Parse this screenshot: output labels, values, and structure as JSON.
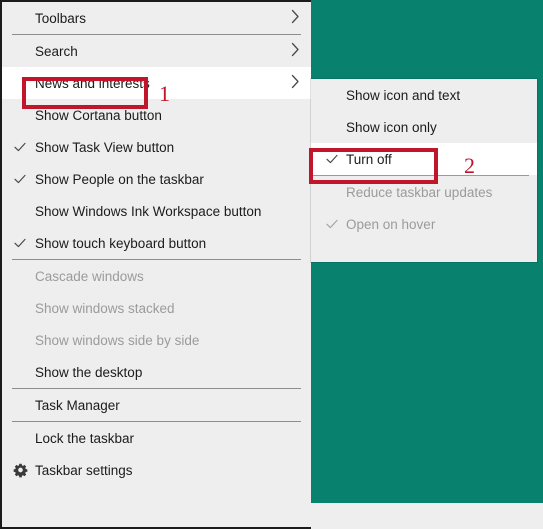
{
  "desktop": {
    "background_color": "#08826f",
    "bottom_strip_color": "#eeeeee"
  },
  "annotations": {
    "accent_color": "#c0152b",
    "step_one": "1",
    "step_two": "2",
    "step_one_target": "News and interests",
    "step_two_target": "Turn off"
  },
  "context_menu": {
    "name": "taskbar-context-menu",
    "background_color": "#eeeeee",
    "items": [
      {
        "label": "Toolbars",
        "checked": false,
        "submenu": true,
        "disabled": false,
        "highlighted": false,
        "icon": null
      },
      {
        "separator": true
      },
      {
        "label": "Search",
        "checked": false,
        "submenu": true,
        "disabled": false,
        "highlighted": false,
        "icon": null
      },
      {
        "label": "News and interests",
        "checked": false,
        "submenu": true,
        "disabled": false,
        "highlighted": true,
        "icon": null
      },
      {
        "label": "Show Cortana button",
        "checked": false,
        "submenu": false,
        "disabled": false,
        "highlighted": false,
        "icon": null
      },
      {
        "label": "Show Task View button",
        "checked": true,
        "submenu": false,
        "disabled": false,
        "highlighted": false,
        "icon": null
      },
      {
        "label": "Show People on the taskbar",
        "checked": true,
        "submenu": false,
        "disabled": false,
        "highlighted": false,
        "icon": null
      },
      {
        "label": "Show Windows Ink Workspace button",
        "checked": false,
        "submenu": false,
        "disabled": false,
        "highlighted": false,
        "icon": null
      },
      {
        "label": "Show touch keyboard button",
        "checked": true,
        "submenu": false,
        "disabled": false,
        "highlighted": false,
        "icon": null
      },
      {
        "separator": true
      },
      {
        "label": "Cascade windows",
        "checked": false,
        "submenu": false,
        "disabled": true,
        "highlighted": false,
        "icon": null
      },
      {
        "label": "Show windows stacked",
        "checked": false,
        "submenu": false,
        "disabled": true,
        "highlighted": false,
        "icon": null
      },
      {
        "label": "Show windows side by side",
        "checked": false,
        "submenu": false,
        "disabled": true,
        "highlighted": false,
        "icon": null
      },
      {
        "label": "Show the desktop",
        "checked": false,
        "submenu": false,
        "disabled": false,
        "highlighted": false,
        "icon": null
      },
      {
        "separator": true
      },
      {
        "label": "Task Manager",
        "checked": false,
        "submenu": false,
        "disabled": false,
        "highlighted": false,
        "icon": null
      },
      {
        "separator": true
      },
      {
        "label": "Lock the taskbar",
        "checked": false,
        "submenu": false,
        "disabled": false,
        "highlighted": false,
        "icon": null
      },
      {
        "label": "Taskbar settings",
        "checked": false,
        "submenu": false,
        "disabled": false,
        "highlighted": false,
        "icon": "gear-icon"
      }
    ]
  },
  "submenu": {
    "name": "news-and-interests-submenu",
    "background_color": "#eeeeee",
    "items": [
      {
        "label": "Show icon and text",
        "checked": false,
        "disabled": false,
        "highlighted": false
      },
      {
        "label": "Show icon only",
        "checked": false,
        "disabled": false,
        "highlighted": false
      },
      {
        "label": "Turn off",
        "checked": true,
        "disabled": false,
        "highlighted": true
      },
      {
        "separator": true
      },
      {
        "label": "Reduce taskbar updates",
        "checked": false,
        "disabled": true,
        "highlighted": false
      },
      {
        "label": "Open on hover",
        "checked": true,
        "disabled": true,
        "highlighted": false
      }
    ]
  },
  "icons": {
    "check": "✓",
    "chevron_right": "chevron-right-icon",
    "gear": "gear-icon"
  }
}
